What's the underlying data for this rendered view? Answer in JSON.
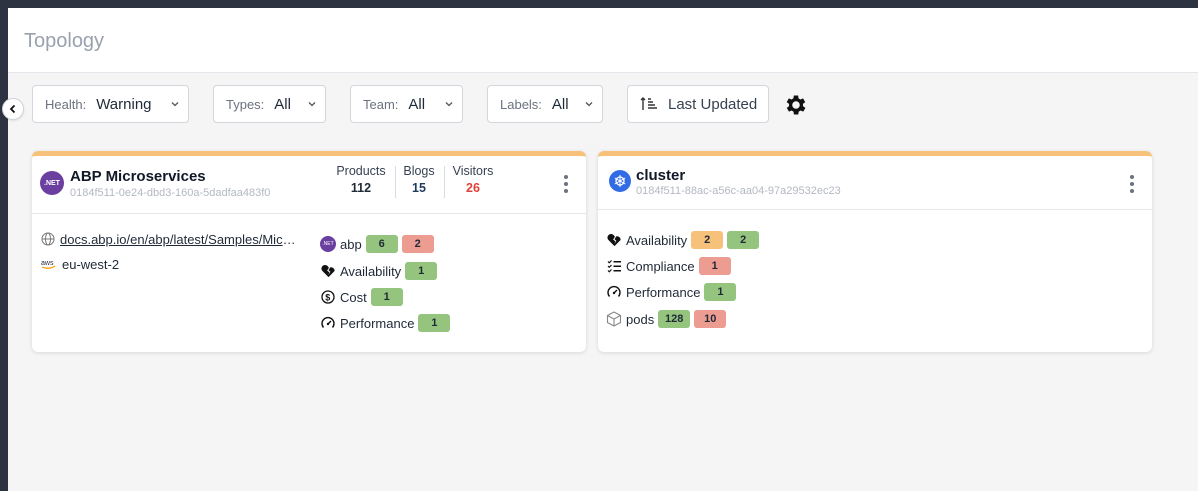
{
  "page": {
    "title": "Topology"
  },
  "filters": {
    "health": {
      "label": "Health:",
      "value": "Warning"
    },
    "types": {
      "label": "Types:",
      "value": "All"
    },
    "team": {
      "label": "Team:",
      "value": "All"
    },
    "labels": {
      "label": "Labels:",
      "value": "All"
    }
  },
  "sort": {
    "label": "Last Updated",
    "icon": "sort-ascending-icon"
  },
  "settings": {
    "icon": "gear-icon"
  },
  "cards": [
    {
      "title": "ABP Microservices",
      "id": "0184f511-0e24-dbd3-160a-5dadfaa483f0",
      "logo_text": ".NET",
      "logo_color": "#6b3fa0",
      "stats": [
        {
          "label": "Products",
          "value": "112",
          "color": "#1f2937"
        },
        {
          "label": "Blogs",
          "value": "15",
          "color": "#1e3a5f"
        },
        {
          "label": "Visitors",
          "value": "26",
          "color": "#e0403a"
        }
      ],
      "properties": [
        {
          "icon": "globe-icon",
          "text": "docs.abp.io/en/abp/latest/Samples/Microservice-Demo"
        },
        {
          "icon": "aws-icon",
          "text": "eu-west-2"
        }
      ],
      "checks": [
        {
          "icon": "dotnet-icon",
          "label": "abp",
          "pills": [
            {
              "value": "6",
              "status": "green"
            },
            {
              "value": "2",
              "status": "red"
            }
          ]
        },
        {
          "icon": "broken-heart-icon",
          "label": "Availability",
          "pills": [
            {
              "value": "1",
              "status": "green"
            }
          ]
        },
        {
          "icon": "dollar-icon",
          "label": "Cost",
          "pills": [
            {
              "value": "1",
              "status": "green"
            }
          ]
        },
        {
          "icon": "speedometer-icon",
          "label": "Performance",
          "pills": [
            {
              "value": "1",
              "status": "green"
            }
          ]
        }
      ]
    },
    {
      "title": "cluster",
      "id": "0184f511-88ac-a56c-aa04-97a29532ec23",
      "logo_color": "#326ce5",
      "checks": [
        {
          "icon": "broken-heart-icon",
          "label": "Availability",
          "pills": [
            {
              "value": "2",
              "status": "orange"
            },
            {
              "value": "2",
              "status": "green"
            }
          ]
        },
        {
          "icon": "checklist-icon",
          "label": "Compliance",
          "pills": [
            {
              "value": "1",
              "status": "red"
            }
          ]
        },
        {
          "icon": "speedometer-icon",
          "label": "Performance",
          "pills": [
            {
              "value": "1",
              "status": "green"
            }
          ]
        },
        {
          "icon": "cube-icon",
          "label": "pods",
          "pills": [
            {
              "value": "128",
              "status": "green"
            },
            {
              "value": "10",
              "status": "red"
            }
          ]
        }
      ]
    }
  ],
  "colors": {
    "accent": "#f6c27b",
    "green": "#95c47e",
    "red": "#ec9c90",
    "orange": "#f6c27b"
  }
}
